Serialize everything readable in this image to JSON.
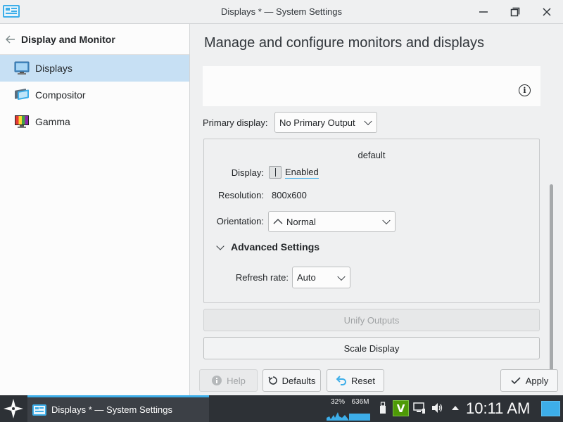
{
  "window": {
    "title": "Displays * — System Settings"
  },
  "sidebar": {
    "title": "Display and Monitor",
    "items": [
      {
        "label": "Displays",
        "icon": "monitor-icon"
      },
      {
        "label": "Compositor",
        "icon": "compositor-icon"
      },
      {
        "label": "Gamma",
        "icon": "gamma-icon"
      }
    ]
  },
  "main": {
    "title": "Manage and configure monitors and displays",
    "primary_display_label": "Primary display:",
    "primary_display_value": "No Primary Output",
    "output": {
      "name": "default",
      "display_label": "Display:",
      "display_value": "Enabled",
      "resolution_label": "Resolution:",
      "resolution_value": "800x600",
      "orientation_label": "Orientation:",
      "orientation_value": "Normal",
      "advanced_label": "Advanced Settings",
      "refresh_label": "Refresh rate:",
      "refresh_value": "Auto"
    },
    "unify_outputs": "Unify Outputs",
    "scale_display": "Scale Display"
  },
  "buttons": {
    "help": "Help",
    "defaults": "Defaults",
    "reset": "Reset",
    "apply": "Apply"
  },
  "taskbar": {
    "task_label": "Displays * — System Settings",
    "cpu": "32%",
    "memory": "636M",
    "clock": "10:11 AM"
  },
  "colors": {
    "accent": "#3daee9",
    "selection": "#c7e0f4",
    "taskbar": "#2d3136",
    "vim_green": "#4e9a06"
  }
}
